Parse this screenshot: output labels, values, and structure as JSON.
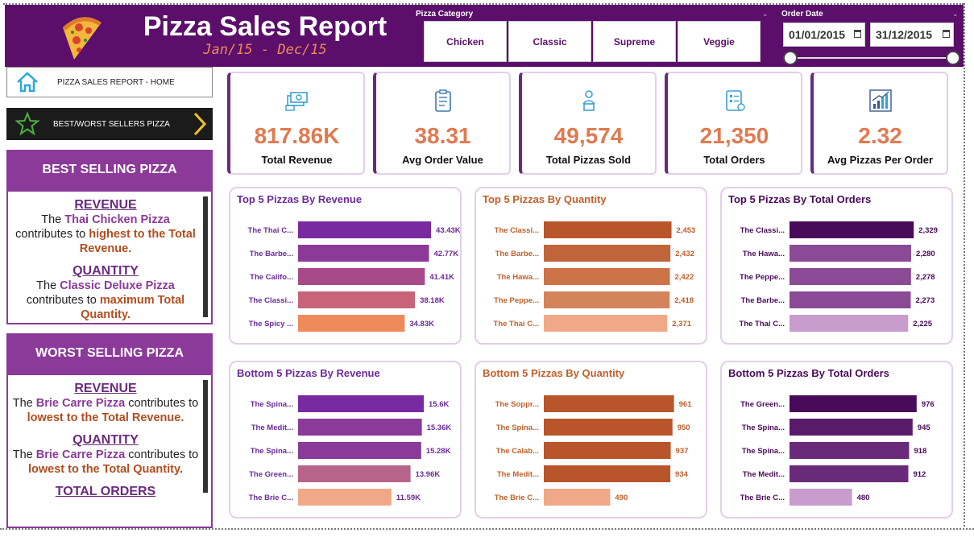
{
  "header": {
    "title": "Pizza Sales Report",
    "subtitle": "Jan/15 - Dec/15",
    "category_label": "Pizza Category",
    "categories": [
      "Chicken",
      "Classic",
      "Supreme",
      "Veggie"
    ],
    "date_label": "Order Date",
    "date_start": "01/01/2015",
    "date_end": "31/12/2015"
  },
  "nav": {
    "home": "PIZZA SALES REPORT - HOME",
    "best": "BEST/WORST SELLERS PIZZA"
  },
  "best": {
    "heading": "BEST SELLING PIZZA",
    "revenue_kw": "REVENUE",
    "revenue_t1": "The ",
    "revenue_name": "Thai Chicken Pizza",
    "revenue_t2": " contributes to ",
    "revenue_hl": "highest to the Total Revenue.",
    "quantity_kw": "QUANTITY",
    "quantity_t1": "The ",
    "quantity_name": "Classic Deluxe Pizza",
    "quantity_t2": " contributes to ",
    "quantity_hl": "maximum Total Quantity."
  },
  "worst": {
    "heading": "WORST SELLING PIZZA",
    "revenue_kw": "REVENUE",
    "revenue_t1": "The ",
    "revenue_name": "Brie Carre Pizza",
    "revenue_t2": " contributes to ",
    "revenue_hl": "lowest to the Total Revenue.",
    "quantity_kw": "QUANTITY",
    "quantity_t1": "The ",
    "quantity_name": "Brie Carre Pizza",
    "quantity_t2": " contributes to ",
    "quantity_hl": "lowest to the Total Quantity.",
    "orders_kw": "TOTAL ORDERS"
  },
  "kpis": [
    {
      "value": "817.86K",
      "label": "Total Revenue",
      "icon": "money-icon"
    },
    {
      "value": "38.31",
      "label": "Avg Order Value",
      "icon": "clipboard-icon"
    },
    {
      "value": "49,574",
      "label": "Total Pizzas Sold",
      "icon": "delivery-icon"
    },
    {
      "value": "21,350",
      "label": "Total Orders",
      "icon": "order-list-icon"
    },
    {
      "value": "2.32",
      "label": "Avg Pizzas Per Order",
      "icon": "bar-growth-icon"
    }
  ],
  "colors": {
    "header": "#5b0f6b",
    "accent": "#8b3a9a",
    "kpi_value": "#e07a50"
  },
  "chart_data": [
    {
      "type": "bar",
      "title": "Top 5 Pizzas By Revenue",
      "title_color": "#6b2a9a",
      "label_color": "#6b2a9a",
      "categories": [
        "The Thai C...",
        "The Barbe...",
        "The Califo...",
        "The Classi...",
        "The Spicy ..."
      ],
      "values": [
        43.43,
        42.77,
        41.41,
        38.18,
        34.83
      ],
      "labels": [
        "43.43K",
        "42.77K",
        "41.41K",
        "38.18K",
        "34.83K"
      ],
      "colors": [
        "#7a2aa0",
        "#8c3a98",
        "#a84a8a",
        "#c8647a",
        "#ee8a5c"
      ],
      "xlim": [
        0,
        50
      ]
    },
    {
      "type": "bar",
      "title": "Top 5 Pizzas By Quantity",
      "title_color": "#c0602a",
      "label_color": "#c0602a",
      "categories": [
        "The Classi...",
        "The Barbe...",
        "The Hawa...",
        "The Peppe...",
        "The Thai C..."
      ],
      "values": [
        2453,
        2432,
        2422,
        2418,
        2371
      ],
      "labels": [
        "2,453",
        "2,432",
        "2,422",
        "2,418",
        "2,371"
      ],
      "colors": [
        "#b8552a",
        "#c0653a",
        "#cc7448",
        "#d4845a",
        "#f0a888"
      ],
      "xlim": [
        0,
        2940
      ]
    },
    {
      "type": "bar",
      "title": "Top 5 Pizzas By Total Orders",
      "title_color": "#4a0a5a",
      "label_color": "#4a0a5a",
      "categories": [
        "The Classi...",
        "The Hawa...",
        "The Peppe...",
        "The Barbe...",
        "The Thai C..."
      ],
      "values": [
        2329,
        2280,
        2278,
        2273,
        2225
      ],
      "labels": [
        "2,329",
        "2,280",
        "2,278",
        "2,273",
        "2,225"
      ],
      "colors": [
        "#4a0a5a",
        "#8a4a96",
        "#8a4a96",
        "#8a4a96",
        "#c89ccc"
      ],
      "xlim": [
        0,
        2870
      ]
    },
    {
      "type": "bar",
      "title": "Bottom 5 Pizzas By Revenue",
      "title_color": "#6b2a9a",
      "label_color": "#6b2a9a",
      "categories": [
        "The Spina...",
        "The Medit...",
        "The Spina...",
        "The Green...",
        "The Brie C..."
      ],
      "values": [
        15.6,
        15.36,
        15.28,
        13.96,
        11.59
      ],
      "labels": [
        "15.6K",
        "15.36K",
        "15.28K",
        "13.96K",
        "11.59K"
      ],
      "colors": [
        "#7a2aa0",
        "#8a3a98",
        "#8a3a98",
        "#b8648a",
        "#f0a888"
      ],
      "xlim": [
        0,
        19
      ]
    },
    {
      "type": "bar",
      "title": "Bottom 5 Pizzas By Quantity",
      "title_color": "#c0602a",
      "label_color": "#c0602a",
      "categories": [
        "The Soppr...",
        "The Spina...",
        "The Calab...",
        "The Medit...",
        "The Brie C..."
      ],
      "values": [
        961,
        950,
        937,
        934,
        490
      ],
      "labels": [
        "961",
        "950",
        "937",
        "934",
        "490"
      ],
      "colors": [
        "#b8552a",
        "#b8552a",
        "#b8552a",
        "#b8552a",
        "#f0a888"
      ],
      "xlim": [
        0,
        1130
      ]
    },
    {
      "type": "bar",
      "title": "Bottom 5 Pizzas By Total Orders",
      "title_color": "#4a0a5a",
      "label_color": "#4a0a5a",
      "categories": [
        "The Green...",
        "The Spina...",
        "The Spina...",
        "The Medit...",
        "The Brie C..."
      ],
      "values": [
        976,
        945,
        918,
        912,
        480
      ],
      "labels": [
        "976",
        "945",
        "918",
        "912",
        "480"
      ],
      "colors": [
        "#4a0a5a",
        "#5a1a6a",
        "#6a2a7a",
        "#6a2a7a",
        "#c89ccc"
      ],
      "xlim": [
        0,
        1175
      ]
    }
  ]
}
